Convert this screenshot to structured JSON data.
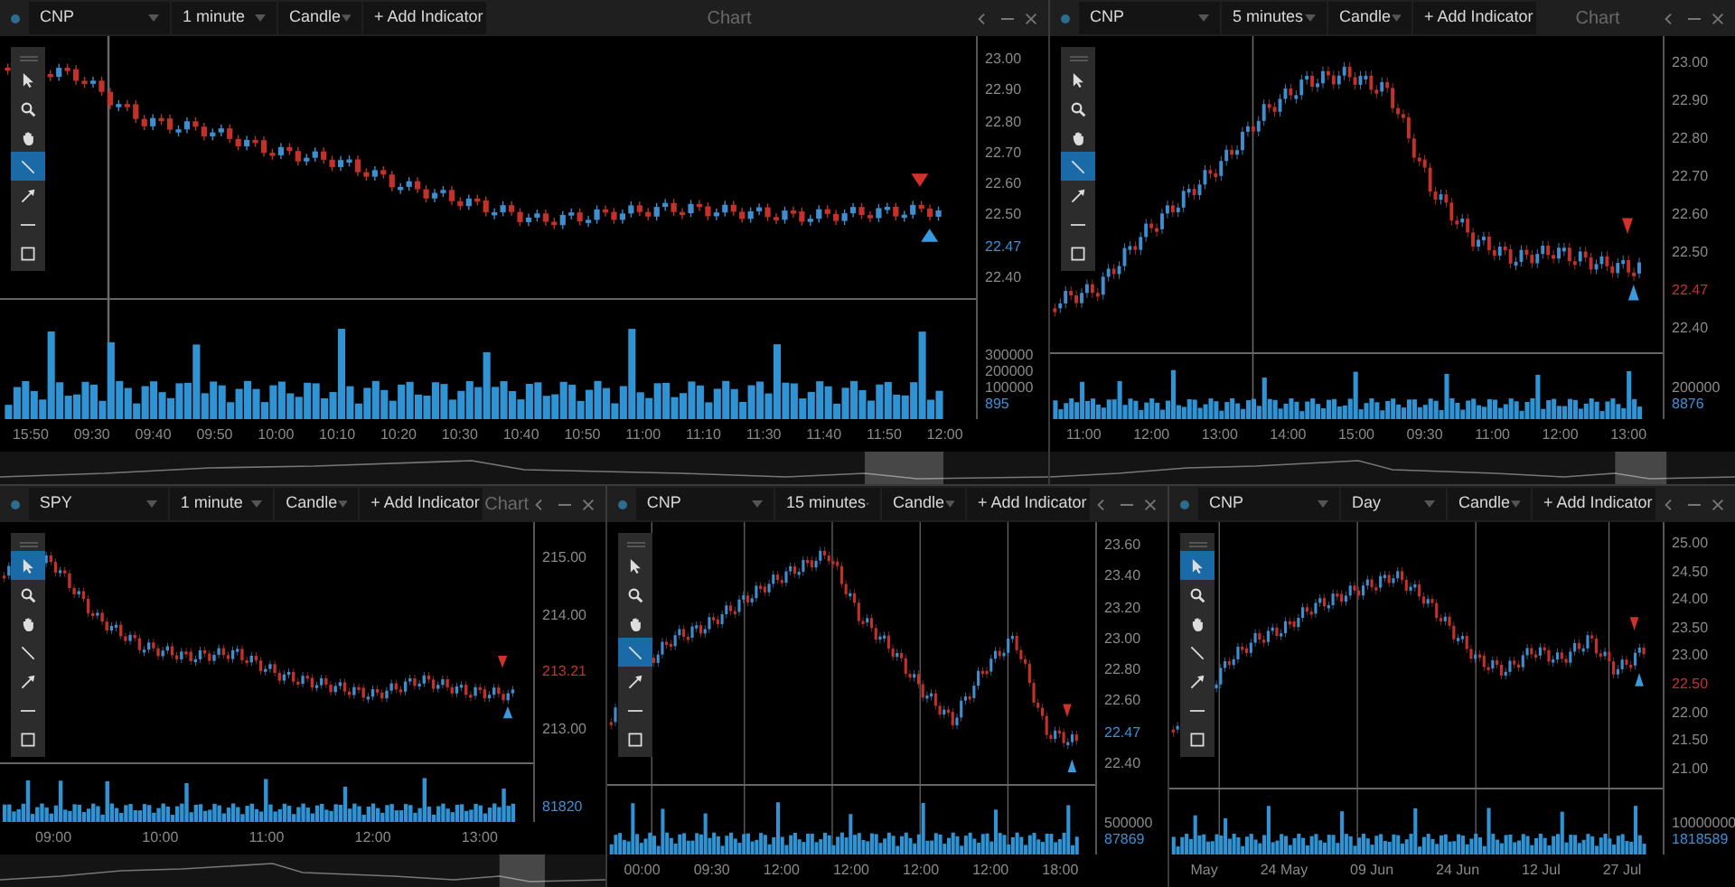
{
  "panels": [
    {
      "symbol": "CNP",
      "interval": "1 minute",
      "chart_type": "Candle",
      "add_indicator": "+ Add Indicator",
      "title": "Chart",
      "navigator": true,
      "tools": [
        {
          "kind": "pointer",
          "selected": false
        },
        {
          "kind": "zoom",
          "selected": false
        },
        {
          "kind": "pan",
          "selected": false
        },
        {
          "kind": "line",
          "selected": true
        },
        {
          "kind": "arrow",
          "selected": false
        },
        {
          "kind": "hline",
          "selected": false
        },
        {
          "kind": "rect",
          "selected": false
        }
      ],
      "price_axis": [
        {
          "label": "23.00",
          "kind": "tick"
        },
        {
          "label": "22.90",
          "kind": "tick"
        },
        {
          "label": "22.80",
          "kind": "tick"
        },
        {
          "label": "22.70",
          "kind": "tick"
        },
        {
          "label": "22.60",
          "kind": "tick"
        },
        {
          "label": "22.50",
          "kind": "tick"
        },
        {
          "label": "22.47",
          "kind": "up"
        },
        {
          "label": "22.40",
          "kind": "tick"
        }
      ],
      "volume_axis": [
        {
          "label": "300000",
          "kind": "tick"
        },
        {
          "label": "200000",
          "kind": "tick"
        },
        {
          "label": "100000",
          "kind": "tick"
        },
        {
          "label": "895",
          "kind": "up"
        }
      ],
      "time_axis": [
        "15:50",
        "09:30",
        "09:40",
        "09:50",
        "10:00",
        "10:10",
        "10:20",
        "10:30",
        "10:40",
        "10:50",
        "11:00",
        "11:10",
        "11:30",
        "11:40",
        "11:50",
        "12:00"
      ]
    },
    {
      "symbol": "CNP",
      "interval": "5 minutes",
      "chart_type": "Candle",
      "add_indicator": "+ Add Indicator",
      "title": "Chart",
      "navigator": true,
      "tools": [
        {
          "kind": "pointer",
          "selected": false
        },
        {
          "kind": "zoom",
          "selected": false
        },
        {
          "kind": "pan",
          "selected": false
        },
        {
          "kind": "line",
          "selected": true
        },
        {
          "kind": "arrow",
          "selected": false
        },
        {
          "kind": "hline",
          "selected": false
        },
        {
          "kind": "rect",
          "selected": false
        }
      ],
      "price_axis": [
        {
          "label": "23.00",
          "kind": "tick"
        },
        {
          "label": "22.90",
          "kind": "tick"
        },
        {
          "label": "22.80",
          "kind": "tick"
        },
        {
          "label": "22.70",
          "kind": "tick"
        },
        {
          "label": "22.60",
          "kind": "tick"
        },
        {
          "label": "22.50",
          "kind": "tick"
        },
        {
          "label": "22.47",
          "kind": "down"
        },
        {
          "label": "22.40",
          "kind": "tick"
        }
      ],
      "volume_axis": [
        {
          "label": "200000",
          "kind": "tick"
        },
        {
          "label": "8876",
          "kind": "up"
        }
      ],
      "time_axis": [
        "11:00",
        "12:00",
        "13:00",
        "14:00",
        "15:00",
        "09:30",
        "11:00",
        "12:00",
        "13:00"
      ]
    },
    {
      "symbol": "SPY",
      "interval": "1 minute",
      "chart_type": "Candle",
      "add_indicator": "+ Add Indicator",
      "title": "Chart",
      "navigator": true,
      "tools": [
        {
          "kind": "pointer",
          "selected": true
        },
        {
          "kind": "zoom",
          "selected": false
        },
        {
          "kind": "pan",
          "selected": false
        },
        {
          "kind": "line",
          "selected": false
        },
        {
          "kind": "arrow",
          "selected": false
        },
        {
          "kind": "hline",
          "selected": false
        },
        {
          "kind": "rect",
          "selected": false
        }
      ],
      "price_axis": [
        {
          "label": "215.00",
          "kind": "tick"
        },
        {
          "label": "214.00",
          "kind": "tick"
        },
        {
          "label": "213.21",
          "kind": "down"
        },
        {
          "label": "213.00",
          "kind": "tick"
        }
      ],
      "volume_axis": [
        {
          "label": "81820",
          "kind": "up"
        }
      ],
      "time_axis": [
        "09:00",
        "10:00",
        "11:00",
        "12:00",
        "13:00"
      ]
    },
    {
      "symbol": "CNP",
      "interval": "15 minutes",
      "chart_type": "Candle",
      "add_indicator": "+ Add Indicator",
      "tools": [
        {
          "kind": "pointer",
          "selected": false
        },
        {
          "kind": "zoom",
          "selected": false
        },
        {
          "kind": "pan",
          "selected": false
        },
        {
          "kind": "line",
          "selected": true
        },
        {
          "kind": "arrow",
          "selected": false
        },
        {
          "kind": "hline",
          "selected": false
        },
        {
          "kind": "rect",
          "selected": false
        }
      ],
      "price_axis": [
        {
          "label": "23.60",
          "kind": "tick"
        },
        {
          "label": "23.40",
          "kind": "tick"
        },
        {
          "label": "23.20",
          "kind": "tick"
        },
        {
          "label": "23.00",
          "kind": "tick"
        },
        {
          "label": "22.80",
          "kind": "tick"
        },
        {
          "label": "22.60",
          "kind": "tick"
        },
        {
          "label": "22.47",
          "kind": "up"
        },
        {
          "label": "22.40",
          "kind": "tick"
        }
      ],
      "volume_axis": [
        {
          "label": "500000",
          "kind": "tick"
        },
        {
          "label": "87869",
          "kind": "up"
        }
      ],
      "time_axis": [
        "00:00",
        "09:30",
        "12:00",
        "12:00",
        "12:00",
        "12:00",
        "18:00"
      ]
    },
    {
      "symbol": "CNP",
      "interval": "Day",
      "chart_type": "Candle",
      "add_indicator": "+ Add Indicator",
      "tools": [
        {
          "kind": "pointer",
          "selected": true
        },
        {
          "kind": "zoom",
          "selected": false
        },
        {
          "kind": "pan",
          "selected": false
        },
        {
          "kind": "line",
          "selected": false
        },
        {
          "kind": "arrow",
          "selected": false
        },
        {
          "kind": "hline",
          "selected": false
        },
        {
          "kind": "rect",
          "selected": false
        }
      ],
      "price_axis": [
        {
          "label": "25.00",
          "kind": "tick"
        },
        {
          "label": "24.50",
          "kind": "tick"
        },
        {
          "label": "24.00",
          "kind": "tick"
        },
        {
          "label": "23.50",
          "kind": "tick"
        },
        {
          "label": "23.00",
          "kind": "tick"
        },
        {
          "label": "22.50",
          "kind": "down"
        },
        {
          "label": "22.00",
          "kind": "tick"
        },
        {
          "label": "21.50",
          "kind": "tick"
        },
        {
          "label": "21.00",
          "kind": "tick"
        }
      ],
      "volume_axis": [
        {
          "label": "10000000",
          "kind": "tick"
        },
        {
          "label": "1818589",
          "kind": "up"
        }
      ],
      "time_axis": [
        "May",
        "24 May",
        "09 Jun",
        "24 Jun",
        "12 Jul",
        "27 Jul"
      ]
    }
  ]
}
